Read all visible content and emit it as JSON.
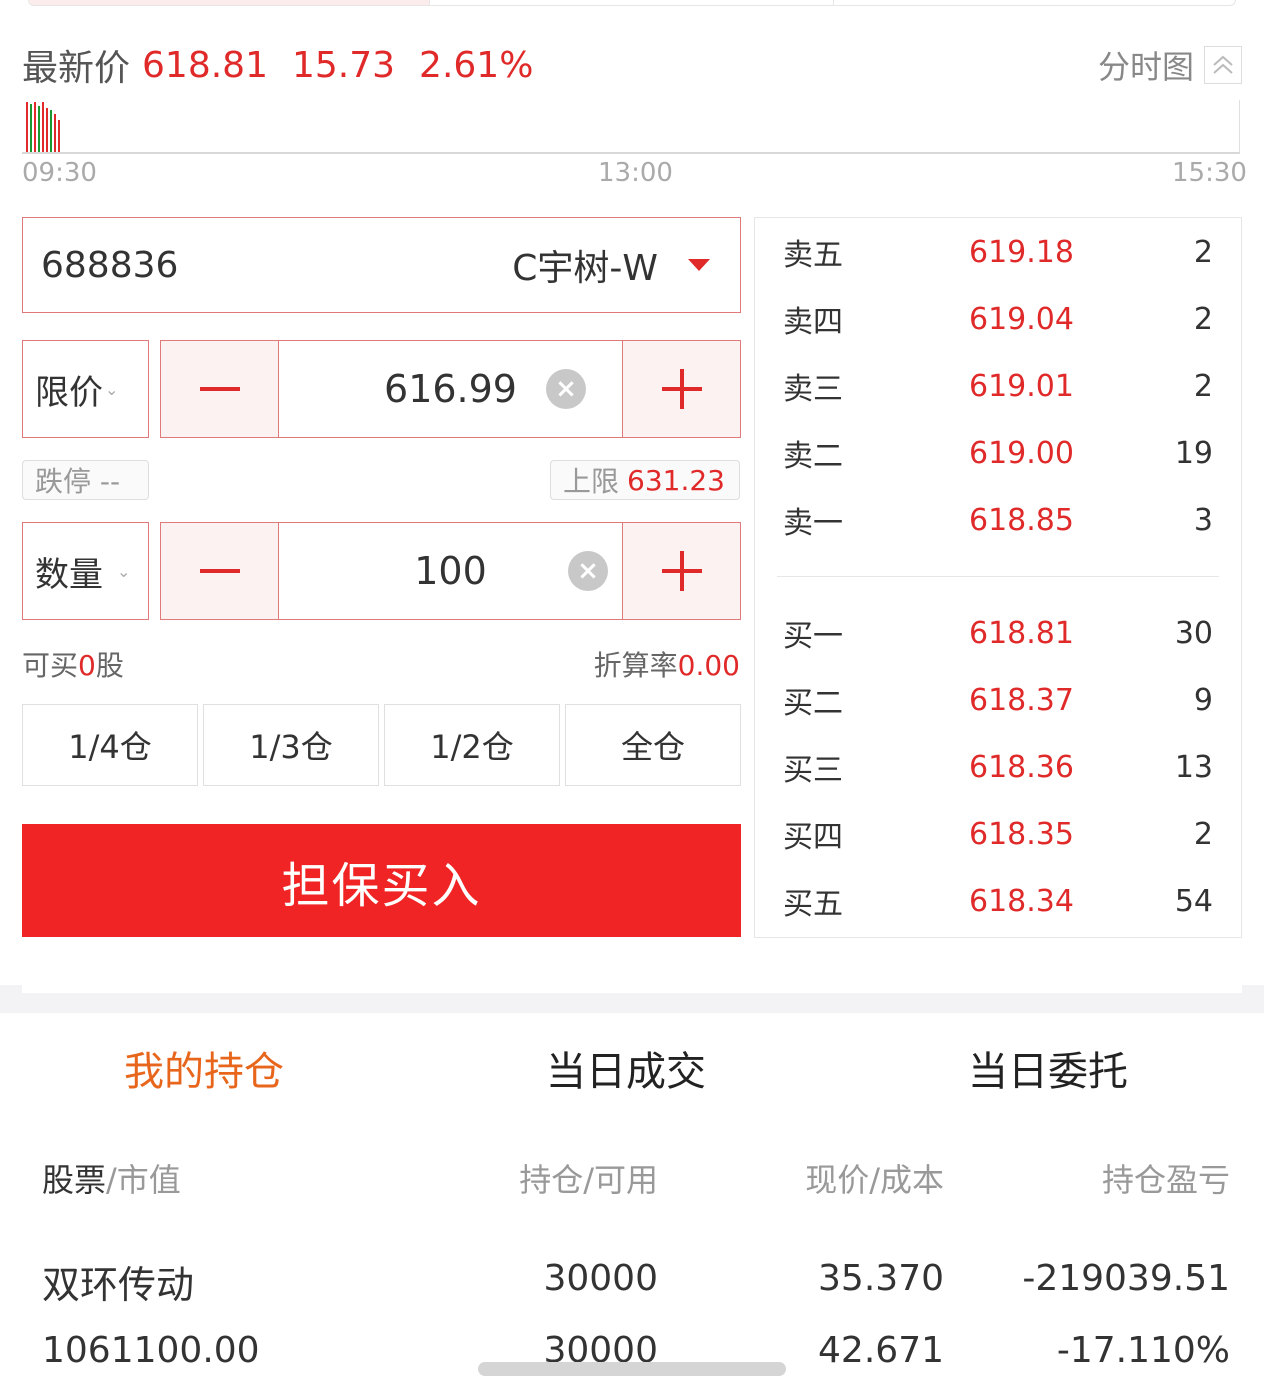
{
  "header": {
    "latest_label": "最新价",
    "latest_price": "618.81",
    "change": "15.73",
    "change_pct": "2.61%",
    "chart_toggle_label": "分时图"
  },
  "mini_chart": {
    "times": [
      "09:30",
      "13:00",
      "15:30"
    ]
  },
  "order_form": {
    "stock_code": "688836",
    "stock_name": "C宇树-W",
    "price_type": "限价",
    "price_value": "616.99",
    "lower_limit_label": "跌停 --",
    "upper_limit_label": "上限",
    "upper_limit_value": "631.23",
    "qty_type": "数量",
    "qty_value": "100",
    "can_buy_prefix": "可买",
    "can_buy_value": "0",
    "can_buy_suffix": "股",
    "discount_label": "折算率",
    "discount_value": "0.00",
    "positions": [
      "1/4仓",
      "1/3仓",
      "1/2仓",
      "全仓"
    ],
    "submit_label": "担保买入"
  },
  "order_book": {
    "asks": [
      {
        "label": "卖五",
        "price": "619.18",
        "qty": "2"
      },
      {
        "label": "卖四",
        "price": "619.04",
        "qty": "2"
      },
      {
        "label": "卖三",
        "price": "619.01",
        "qty": "2"
      },
      {
        "label": "卖二",
        "price": "619.00",
        "qty": "19"
      },
      {
        "label": "卖一",
        "price": "618.85",
        "qty": "3"
      }
    ],
    "bids": [
      {
        "label": "买一",
        "price": "618.81",
        "qty": "30"
      },
      {
        "label": "买二",
        "price": "618.37",
        "qty": "9"
      },
      {
        "label": "买三",
        "price": "618.36",
        "qty": "13"
      },
      {
        "label": "买四",
        "price": "618.35",
        "qty": "2"
      },
      {
        "label": "买五",
        "price": "618.34",
        "qty": "54"
      }
    ]
  },
  "tabs": [
    "我的持仓",
    "当日成交",
    "当日委托"
  ],
  "holdings": {
    "columns": {
      "stock": "股票",
      "market_value": "/市值",
      "position": "持仓/可用",
      "price": "现价/成本",
      "pnl": "持仓盈亏"
    },
    "rows": [
      {
        "name": "双环传动",
        "market_value": "1061100.00",
        "position": "30000",
        "available": "30000",
        "current_price": "35.370",
        "cost": "42.671",
        "pnl": "-219039.51",
        "pnl_pct": "-17.110%"
      }
    ]
  },
  "colors": {
    "up_red": "#e02a2a",
    "down_green": "#1a9a2e",
    "active_tab": "#e8661c",
    "buy_button": "#f02424"
  }
}
